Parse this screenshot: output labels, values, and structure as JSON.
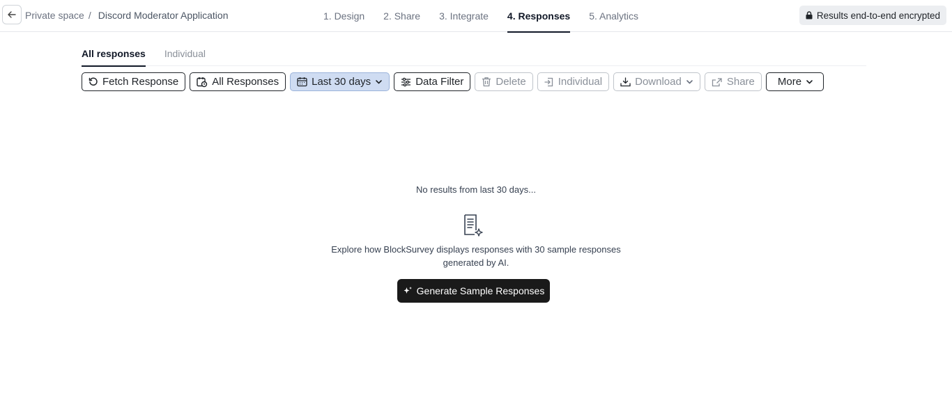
{
  "header": {
    "breadcrumb_parent": "Private space",
    "breadcrumb_sep": "/",
    "breadcrumb_current": "Discord Moderator Application",
    "steps": [
      {
        "label": "1. Design"
      },
      {
        "label": "2. Share"
      },
      {
        "label": "3. Integrate"
      },
      {
        "label": "4. Responses"
      },
      {
        "label": "5. Analytics"
      }
    ],
    "active_step": "4. Responses",
    "encrypted_label": "Results end-to-end encrypted"
  },
  "subtabs": [
    {
      "label": "All responses"
    },
    {
      "label": "Individual"
    }
  ],
  "active_subtab": "All responses",
  "toolbar": {
    "fetch": "Fetch Response",
    "all_responses": "All Responses",
    "date_range": "Last 30 days",
    "data_filter": "Data Filter",
    "delete": "Delete",
    "individual": "Individual",
    "download": "Download",
    "share": "Share",
    "more": "More"
  },
  "empty_state": {
    "title": "No results from last 30 days...",
    "desc_line1": "Explore how BlockSurvey displays responses with 30 sample responses",
    "desc_line2": "generated by AI.",
    "button": "Generate Sample Responses"
  },
  "icons": {
    "back": "arrow-left-icon",
    "lock": "lock-icon",
    "fetch": "refresh-icon",
    "all_responses": "calendar-clock-icon",
    "date": "calendar-icon",
    "filter": "sliders-icon",
    "delete": "trash-icon",
    "individual": "sign-in-icon",
    "download": "download-icon",
    "share": "share-icon",
    "chevron": "chevron-down-icon",
    "doc": "document-sparkle-icon",
    "sparkle": "sparkle-icon"
  },
  "colors": {
    "primary_dark": "#1a1a1a",
    "selected_bg": "#cfdcf2",
    "muted_text": "#8a9099"
  }
}
